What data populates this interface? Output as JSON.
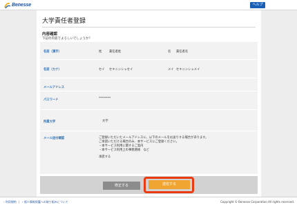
{
  "header": {
    "logo_text": "Benesse",
    "help_label": "ヘルプ",
    "brand_color": "#1a5fb4"
  },
  "main": {
    "title": "大学責任者登録",
    "section_title": "内容確認",
    "section_subtitle": "下記の内容でよろしいでしょうか？"
  },
  "form": {
    "name_kanji": {
      "label": "名前（漢字）",
      "last_prefix": "姓",
      "last_value": "責任者姓",
      "first_prefix": "名",
      "first_value": "責任者名"
    },
    "name_kana": {
      "label": "名前（カナ）",
      "last_prefix": "セイ",
      "last_value": "セキニンシャセイ",
      "first_prefix": "メイ",
      "first_value": "セキニンシャメイ"
    },
    "email": {
      "label": "メールアドレス",
      "value": ""
    },
    "password": {
      "label": "パスワード",
      "value": "********"
    },
    "university": {
      "label": "所属大学",
      "value": "大学"
    },
    "email_consent": {
      "label": "メール送付確認",
      "lines": [
        "ご登録いただいたメールアドレスに、以下のメールをお送りする場合があります。",
        "ご承諾いただける場合のみ、本サービスにご登録ください。",
        "・本サービス利用に関するご案内",
        "・本サービス利用上の事務連絡　など"
      ],
      "answer": "承諾する"
    }
  },
  "actions": {
    "back_label": "修正する",
    "send_label": "送信する",
    "highlight_color": "#ea3b10",
    "send_color": "#f0a431"
  },
  "footer": {
    "link1": "利用規約",
    "link2": "個人情報保護への取り組みについて",
    "copyright": "Copyright © Benesse Corporation All rights reserved."
  }
}
